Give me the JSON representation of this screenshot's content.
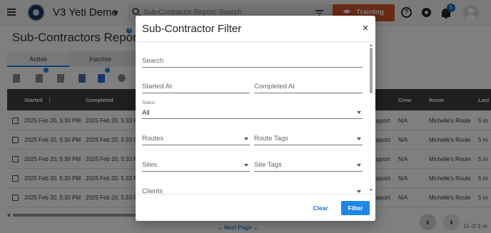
{
  "topbar": {
    "app_name": "V3 Yeti Demo",
    "search_placeholder": "Sub-Contractor Report: Search",
    "training_label": "Training",
    "notification_count": "5",
    "help_glyph": "?"
  },
  "page": {
    "title": "Sub-Contractors Report",
    "title_help_glyph": "?",
    "tabs": [
      {
        "label": "Active",
        "selected": true
      },
      {
        "label": "Inactive",
        "selected": false
      }
    ],
    "toolbar_icons": [
      "trash-icon",
      "export-icon",
      "settings-report-icon",
      "columns-icon",
      "dollar-icon",
      "hidden-icon"
    ]
  },
  "table": {
    "columns": {
      "started": "Started",
      "completed": "Completed",
      "crew": "Crew",
      "route": "Route",
      "last": "Last"
    },
    "sort_arrow": "↓",
    "rows": [
      {
        "started": "2025 Feb 20, 5:30 PM",
        "completed": "2025 Feb 20, 5:33 P",
        "partial": "upport",
        "crew": "N/A",
        "route": "Michelle's Route",
        "last": "5 m"
      },
      {
        "started": "2025 Feb 20, 5:30 PM",
        "completed": "2025 Feb 20, 5:33 P",
        "partial": "upport",
        "crew": "N/A",
        "route": "Michelle's Route",
        "last": "5 m"
      },
      {
        "started": "2025 Feb 20, 5:30 PM",
        "completed": "2025 Feb 20, 5:33 P",
        "partial": "upport",
        "crew": "N/A",
        "route": "Michelle's Route",
        "last": "5 m"
      },
      {
        "started": "2025 Feb 20, 5:30 PM",
        "completed": "2025 Feb 20, 5:33 P",
        "partial": "upport",
        "crew": "N/A",
        "route": "Michelle's Route",
        "last": "5 m"
      },
      {
        "started": "2025 Feb 20, 5:30 PM",
        "completed": "2025 Feb 20, 5:33 P",
        "partial": "upport",
        "crew": "N/A",
        "route": "Michelle's Route",
        "last": "5 m"
      }
    ]
  },
  "pagination": {
    "next_page_label": "Next Page",
    "prev_glyph": "‹",
    "next_glyph": "›",
    "count_text": "15 of 2 re"
  },
  "modal": {
    "title": "Sub-Contractor Filter",
    "close_glyph": "×",
    "search_placeholder": "Search",
    "started_at_placeholder": "Started At",
    "completed_at_placeholder": "Completed At",
    "status_label": "Status",
    "status_value": "All",
    "routes_placeholder": "Routes",
    "route_tags_placeholder": "Route Tags",
    "sites_placeholder": "Sites",
    "site_tags_placeholder": "Site Tags",
    "clients_placeholder": "Clients",
    "clear_label": "Clear",
    "filter_label": "Filter"
  },
  "colors": {
    "accent": "#1e88e5",
    "training": "#d4572a",
    "table_header": "#3f3f3f"
  }
}
